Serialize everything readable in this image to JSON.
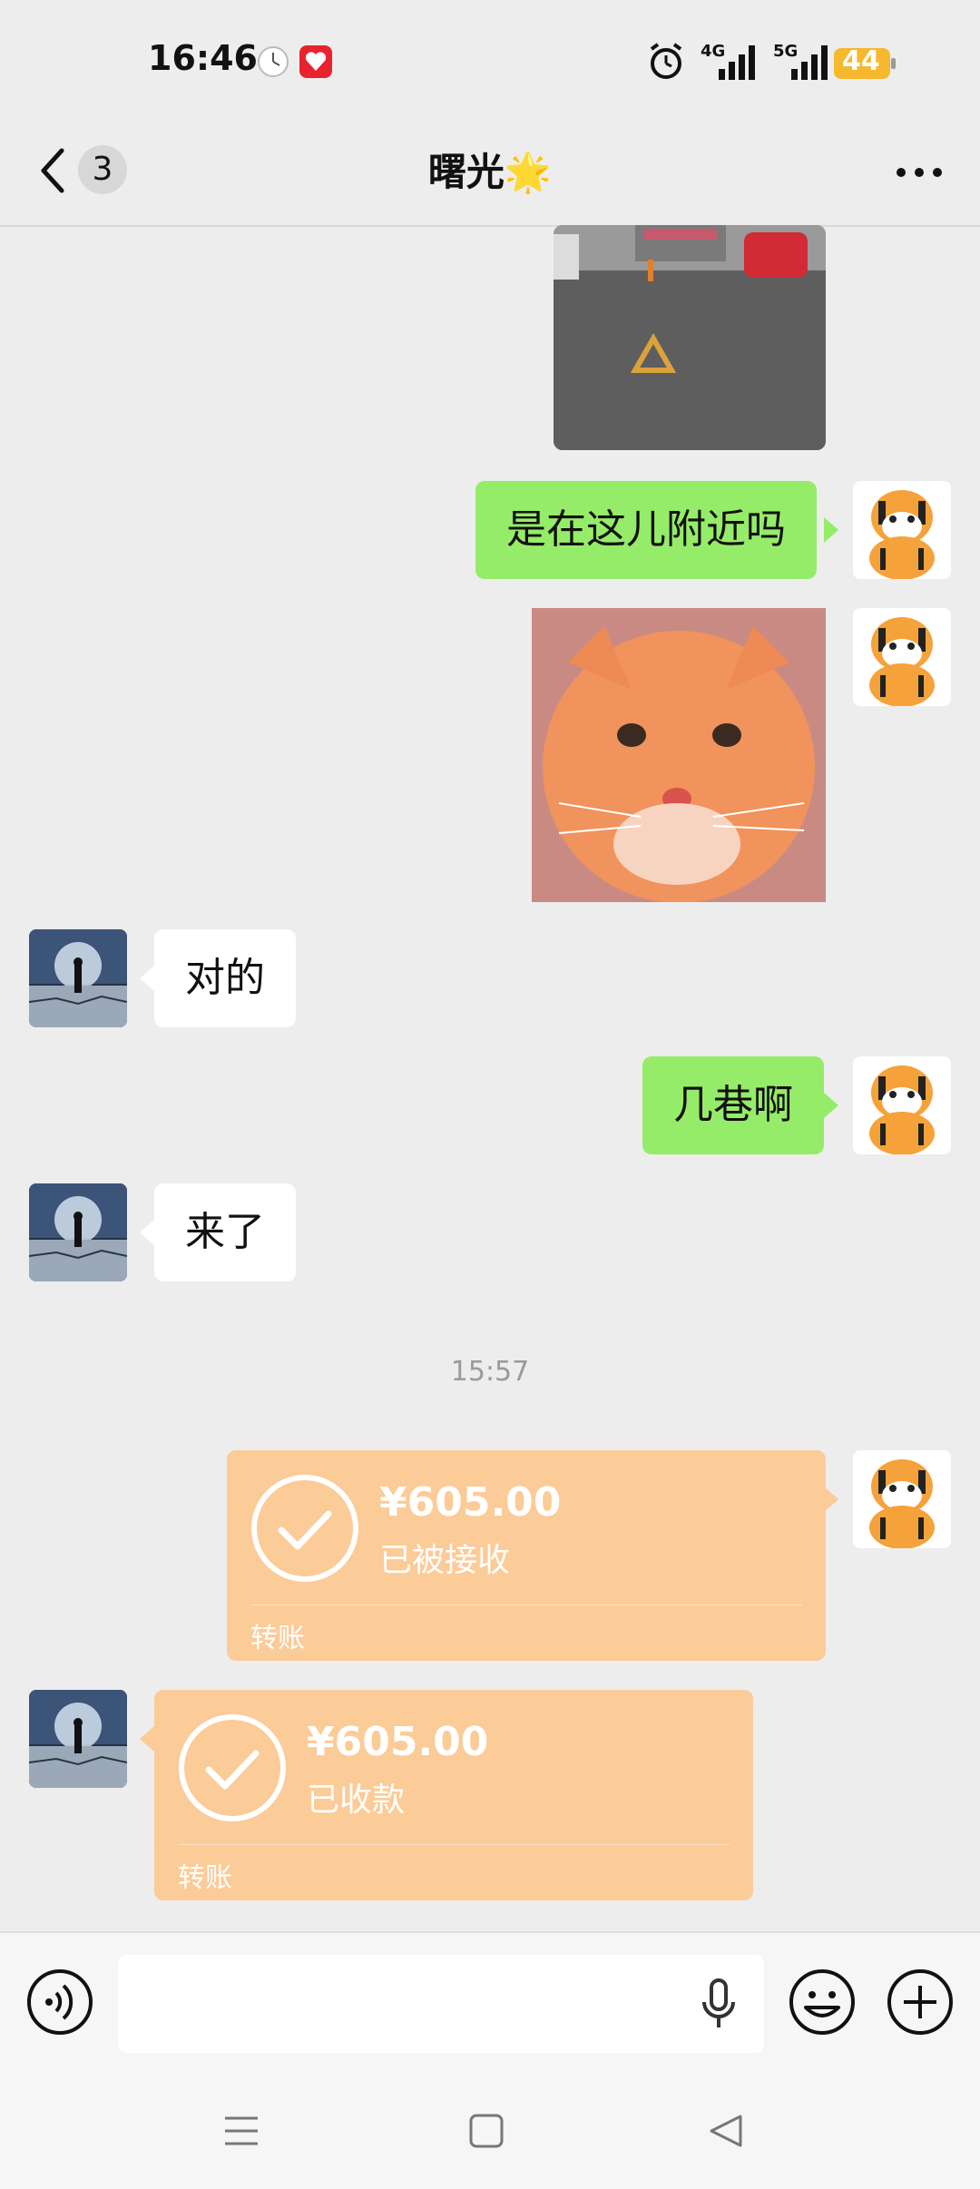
{
  "status_bar": {
    "time": "16:46",
    "battery": "44",
    "network_1": "4G",
    "network_2": "5G",
    "icons": [
      "clock-icon",
      "app-badge-icon",
      "alarm-icon",
      "signal-4g-icon",
      "signal-5g-icon",
      "battery-icon"
    ]
  },
  "header": {
    "unread_count": "3",
    "title": "曙光🌟"
  },
  "messages": {
    "m1_text": "是在这儿附近吗",
    "m3_text": "对的",
    "m4_text": "几巷啊",
    "m5_text": "来了",
    "timestamp": "15:57",
    "transfer_out": {
      "amount": "¥605.00",
      "status": "已被接收",
      "label": "转账"
    },
    "transfer_in": {
      "amount": "¥605.00",
      "status": "已收款",
      "label": "转账"
    }
  },
  "input_bar": {
    "placeholder": "",
    "icons": [
      "voice-icon",
      "mic-icon",
      "emoji-icon",
      "plus-icon"
    ]
  },
  "colors": {
    "outgoing_bubble": "#95ec69",
    "incoming_bubble": "#ffffff",
    "transfer_card": "#fbcb98",
    "background": "#ededed"
  }
}
